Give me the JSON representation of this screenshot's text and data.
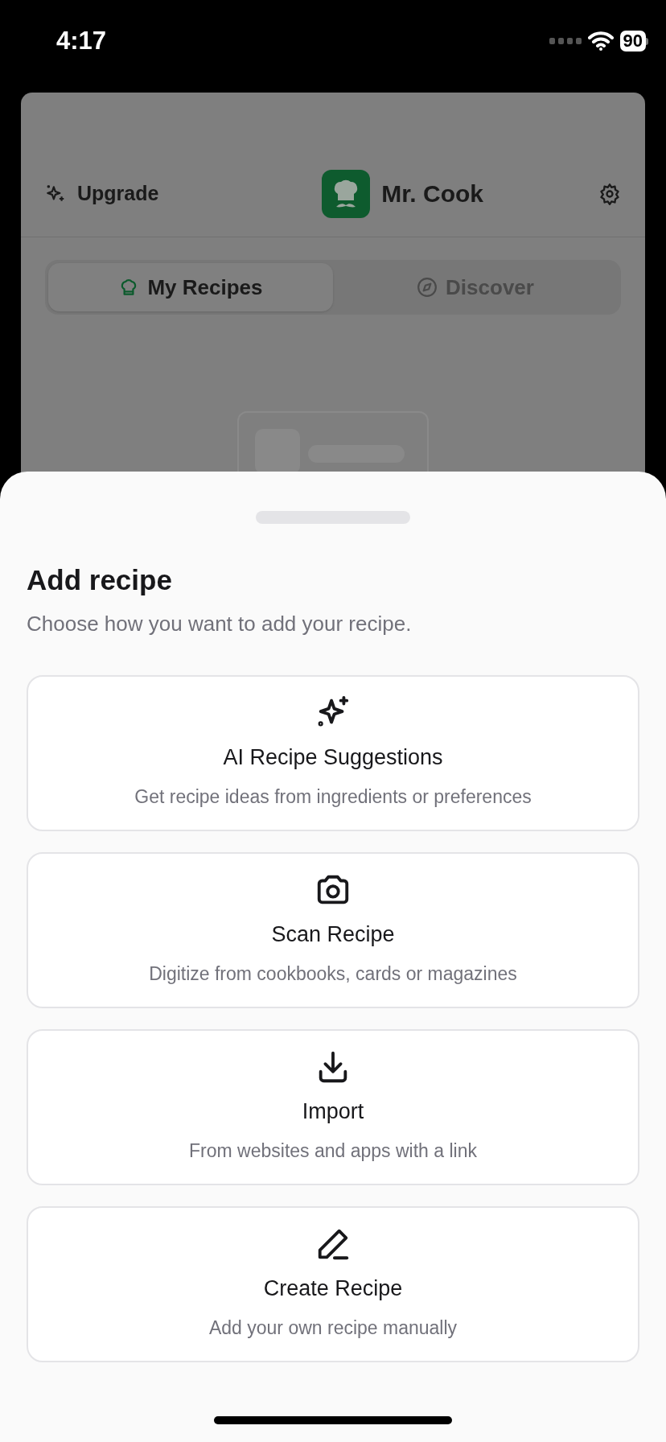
{
  "status_bar": {
    "time": "4:17",
    "battery": "90"
  },
  "header": {
    "upgrade": "Upgrade",
    "app_name": "Mr. Cook"
  },
  "tabs": [
    {
      "label": "My Recipes",
      "selected": true,
      "kind": "hat"
    },
    {
      "label": "Discover",
      "selected": false,
      "kind": "compass"
    }
  ],
  "sheet": {
    "title": "Add recipe",
    "subtitle": "Choose how you want to add your recipe.",
    "options": [
      {
        "kind": "sparkles",
        "title": "AI Recipe Suggestions",
        "description": "Get recipe ideas from ingredients or preferences"
      },
      {
        "kind": "camera",
        "title": "Scan Recipe",
        "description": "Digitize from cookbooks, cards or magazines"
      },
      {
        "kind": "import",
        "title": "Import",
        "description": "From websites and apps with a link"
      },
      {
        "kind": "pencil",
        "title": "Create Recipe",
        "description": "Add your own recipe manually"
      }
    ]
  }
}
